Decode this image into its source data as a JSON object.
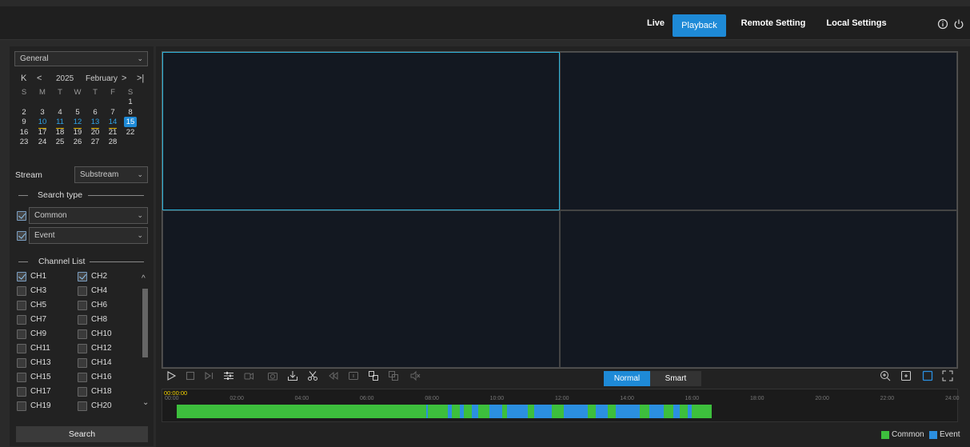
{
  "nav": {
    "live": "Live",
    "playback": "Playback",
    "remote_setting": "Remote Setting",
    "local_settings": "Local Settings"
  },
  "sidebar": {
    "general_select": "General",
    "calendar": {
      "year": "2025",
      "month": "February",
      "dow": [
        "S",
        "M",
        "T",
        "W",
        "T",
        "F",
        "S"
      ],
      "days": [
        "1",
        "2",
        "3",
        "4",
        "5",
        "6",
        "7",
        "8",
        "9",
        "10",
        "11",
        "12",
        "13",
        "14",
        "15",
        "16",
        "17",
        "18",
        "19",
        "20",
        "21",
        "22",
        "23",
        "24",
        "25",
        "26",
        "27",
        "28"
      ],
      "recorded_days": [
        "10",
        "11",
        "12",
        "13",
        "14"
      ],
      "selected_day": "15"
    },
    "stream_label": "Stream",
    "stream_value": "Substream",
    "search_type_label": "Search type",
    "common_label": "Common",
    "event_label": "Event",
    "channel_list_label": "Channel List",
    "channels": [
      {
        "name": "CH1",
        "checked": true
      },
      {
        "name": "CH2",
        "checked": true
      },
      {
        "name": "CH3",
        "checked": false
      },
      {
        "name": "CH4",
        "checked": false
      },
      {
        "name": "CH5",
        "checked": false
      },
      {
        "name": "CH6",
        "checked": false
      },
      {
        "name": "CH7",
        "checked": false
      },
      {
        "name": "CH8",
        "checked": false
      },
      {
        "name": "CH9",
        "checked": false
      },
      {
        "name": "CH10",
        "checked": false
      },
      {
        "name": "CH11",
        "checked": false
      },
      {
        "name": "CH12",
        "checked": false
      },
      {
        "name": "CH13",
        "checked": false
      },
      {
        "name": "CH14",
        "checked": false
      },
      {
        "name": "CH15",
        "checked": false
      },
      {
        "name": "CH16",
        "checked": false
      },
      {
        "name": "CH17",
        "checked": false
      },
      {
        "name": "CH18",
        "checked": false
      },
      {
        "name": "CH19",
        "checked": false
      },
      {
        "name": "CH20",
        "checked": false
      }
    ],
    "search_button": "Search"
  },
  "playback": {
    "mode_normal": "Normal",
    "mode_smart": "Smart",
    "current_time": "00:00:00",
    "time_ticks": [
      "00:00",
      "02:00",
      "04:00",
      "06:00",
      "08:00",
      "10:00",
      "12:00",
      "14:00",
      "16:00",
      "18:00",
      "20:00",
      "22:00",
      "24:00"
    ],
    "legend_common": "Common",
    "legend_event": "Event",
    "colors": {
      "common": "#3dbf3d",
      "event": "#2b8fe0",
      "accent": "#1e8ad7"
    }
  }
}
